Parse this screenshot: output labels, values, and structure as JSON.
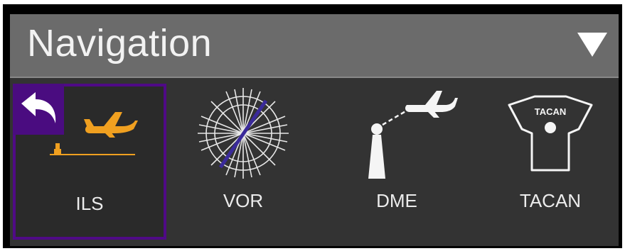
{
  "header": {
    "title": "Navigation",
    "dropdown_icon": "triangle-down-icon"
  },
  "tiles": [
    {
      "label": "ILS",
      "icon": "ils-airplane-icon",
      "selected": true,
      "back_icon": "back-arrow-icon"
    },
    {
      "label": "VOR",
      "icon": "vor-compass-rose-icon",
      "selected": false
    },
    {
      "label": "DME",
      "icon": "dme-station-icon",
      "selected": false
    },
    {
      "label": "TACAN",
      "icon": "tacan-beacon-icon",
      "badge_text": "TACAN",
      "selected": false
    }
  ],
  "colors": {
    "panel": "#333333",
    "header": "#6b6b6b",
    "selected_border": "#4f0a86",
    "ils_accent": "#f0a020",
    "vor_needle": "#3a2a9a",
    "icon": "#f5f5f5"
  }
}
